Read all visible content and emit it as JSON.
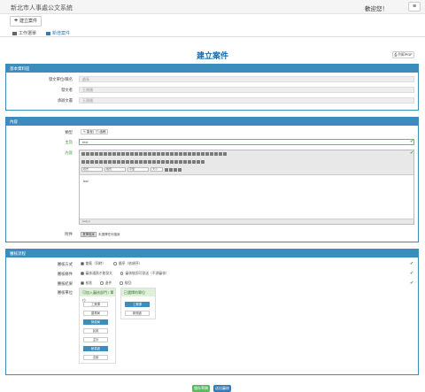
{
  "header": {
    "brand": "新北市人事處公文系統",
    "welcome": "歡迎您！",
    "menu_icon": "hamburger-icon"
  },
  "toolbar": {
    "create_label": "建立案件"
  },
  "tabs": [
    {
      "label": "工作選單"
    },
    {
      "label": "新增案件"
    }
  ],
  "page": {
    "title": "建立案件",
    "print_label": "列印PDF"
  },
  "basic": {
    "heading": "基本資料區",
    "rows": [
      {
        "label": "發文單位/職名",
        "value": "處長"
      },
      {
        "label": "發文者",
        "value": "王建國"
      },
      {
        "label": "承辦文書",
        "value": "王建國"
      }
    ]
  },
  "content": {
    "heading": "內容",
    "type_label": "類型",
    "type_buttons": [
      "簽呈",
      "函稿"
    ],
    "subject_label": "主旨",
    "subject_value": "test",
    "body_label": "內容",
    "editor_select_1": "樣式",
    "editor_select_2": "格式",
    "editor_select_3": "字型",
    "editor_select_4": "大小",
    "editor_body": "test",
    "editor_status": "body p",
    "attach_label": "附件",
    "attach_button": "選擇檔案",
    "attach_text": "未選擇任何檔案"
  },
  "flow": {
    "heading": "審核流程",
    "rows": [
      {
        "label": "審核方式",
        "options": [
          "會簽（同時）",
          "循序（依順序）"
        ],
        "selected": 0
      },
      {
        "label": "審核條件",
        "options": [
          "審核通過才能發文",
          "審核後即可發送（不須審核）"
        ],
        "selected": 0
      },
      {
        "label": "審核結果",
        "options": [
          "核准",
          "退件",
          "駁回"
        ],
        "selected": 0
      }
    ],
    "route_label": "審核單位",
    "left_box_title": "可加入審核部門 / 單位",
    "left_items": [
      {
        "label": "工務課",
        "selected": false
      },
      {
        "label": "農業局",
        "selected": false
      },
      {
        "label": "財政局",
        "selected": true
      },
      {
        "label": "民政",
        "selected": false
      },
      {
        "label": "主計",
        "selected": false
      },
      {
        "label": "秘書處",
        "selected": true
      },
      {
        "label": "法制",
        "selected": false
      }
    ],
    "right_box_title": "已選擇的單位",
    "right_items": [
      {
        "label": "工務課",
        "selected": true
      },
      {
        "label": "新聞處",
        "selected": false
      }
    ]
  },
  "footer": {
    "save_label": "儲存草稿",
    "submit_label": "送出審核"
  },
  "colors": {
    "accent": "#3c8dbc",
    "success": "#5cb85c",
    "primary": "#337ab7"
  }
}
